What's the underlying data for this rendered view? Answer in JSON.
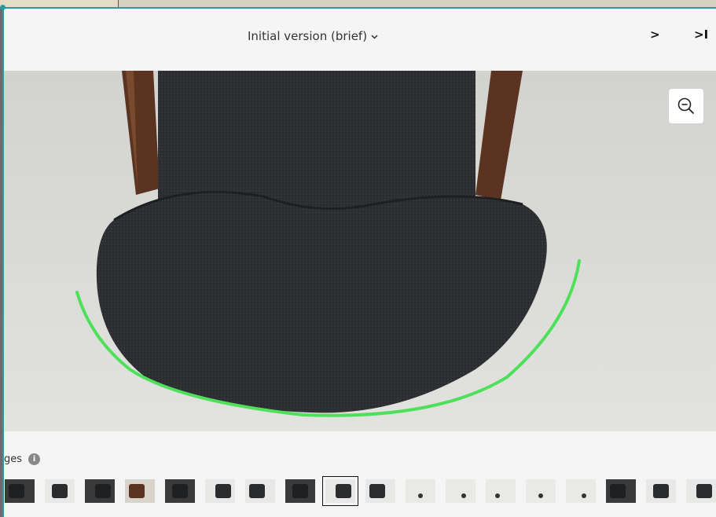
{
  "header": {
    "version_label": "Initial version (brief)",
    "next_label": ">",
    "last_label": ">I"
  },
  "viewer": {
    "zoom_icon": "zoom-out-icon",
    "annotation_color": "#4ee05a"
  },
  "images": {
    "label": "ges",
    "info_icon": "info-icon",
    "selected_index": 8,
    "thumbnails": [
      {
        "scene": "chair-side-dark-bg"
      },
      {
        "scene": "chair-front-light"
      },
      {
        "scene": "chair-back-dark"
      },
      {
        "scene": "chair-side-wood"
      },
      {
        "scene": "chair-top-dark"
      },
      {
        "scene": "chair-side-angle"
      },
      {
        "scene": "chair-leaning"
      },
      {
        "scene": "chair-front-dark"
      },
      {
        "scene": "chair-top-selected"
      },
      {
        "scene": "chair-back-angle"
      },
      {
        "scene": "room-empty-1"
      },
      {
        "scene": "room-chair-small"
      },
      {
        "scene": "room-empty-2"
      },
      {
        "scene": "room-chair-left"
      },
      {
        "scene": "room-empty-3"
      },
      {
        "scene": "chair-side-dark"
      },
      {
        "scene": "chair-lying"
      },
      {
        "scene": "chair-edge"
      }
    ]
  }
}
